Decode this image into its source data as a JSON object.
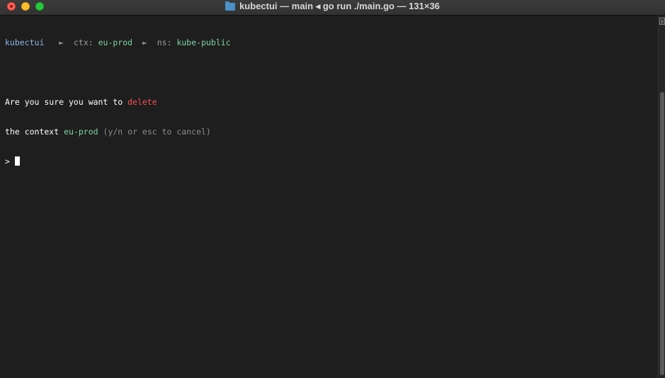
{
  "window": {
    "title": "kubectui — main ◂ go run ./main.go — 131×36",
    "icon": "folder-icon"
  },
  "colors": {
    "app": "#8fb6e6",
    "value": "#7fd3a4",
    "danger": "#f0524f",
    "muted": "#8e8e8e",
    "background": "#1e1e1e"
  },
  "header": {
    "app": "kubectui",
    "sep1": "►",
    "ctx_label": "ctx:",
    "ctx_value": "eu-prod",
    "sep2": "►",
    "ns_label": "ns:",
    "ns_value": "kube-public"
  },
  "prompt": {
    "line1_text": "Are you sure you want to",
    "line1_action": "delete",
    "line2_text": "the context",
    "line2_value": "eu-prod",
    "line2_hint": "(y/n or esc to cancel)",
    "input_marker": ">",
    "input_value": ""
  }
}
